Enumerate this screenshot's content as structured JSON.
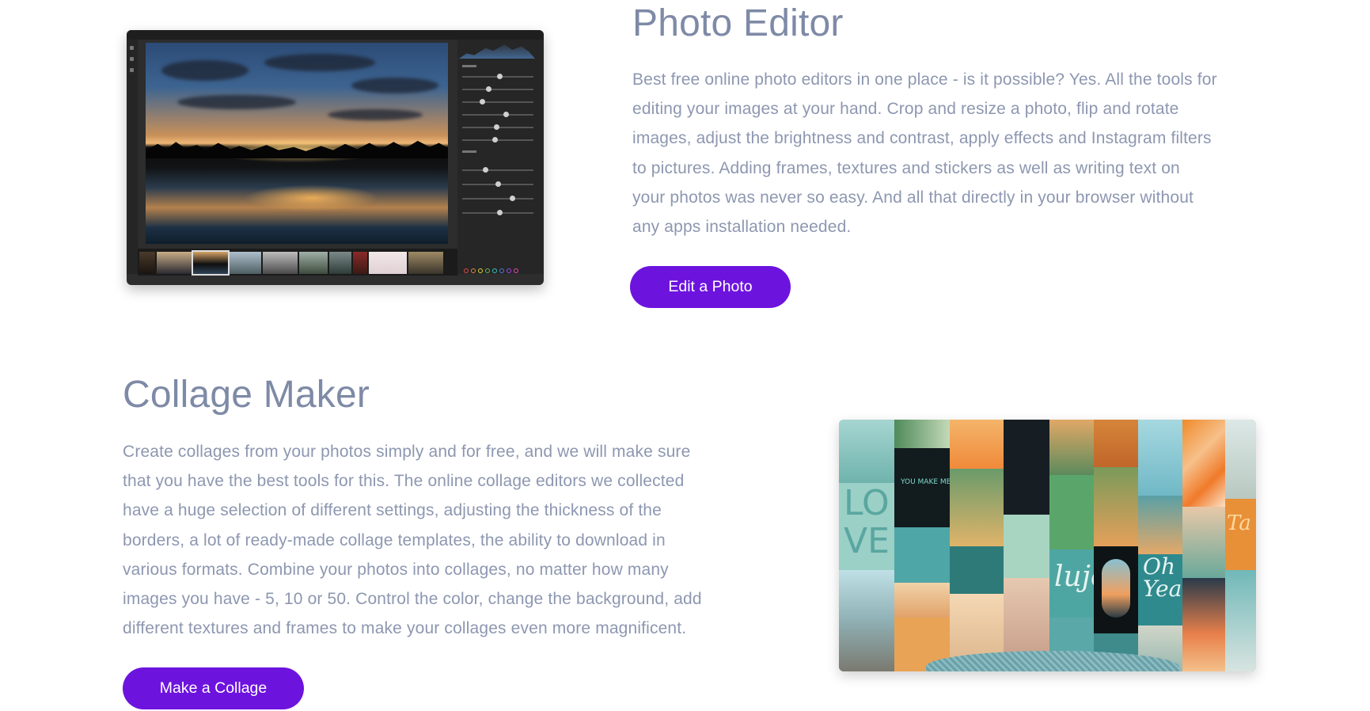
{
  "photo_editor": {
    "title": "Photo Editor",
    "description_lines": [
      "Best free online photo editors in one place - is it possible? Yes. All the tools for",
      "editing your images at your hand. Crop and resize a photo, flip and rotate",
      "images, adjust the brightness and contrast, apply effects and Instagram filters",
      "to pictures. Adding frames, textures and stickers as well as writing text on",
      "your photos was never so easy. And all that directly in your browser without",
      "any apps installation needed."
    ],
    "button_label": "Edit a Photo"
  },
  "collage_maker": {
    "title": "Collage Maker",
    "description_lines": [
      "Create collages from your photos simply and for free, and we will make sure",
      "that you have the best tools for this. The online collage editors we collected",
      "have a huge selection of different settings, adjusting the thickness of the",
      "borders, a lot of ready-made collage templates, the ability to download in",
      "various formats. Combine your photos into collages, no matter how many",
      "images you have - 5, 10 or 50. Control the color, change the background, add",
      "different textures and frames to make your collages even more magnificent."
    ],
    "button_label": "Make a Collage"
  },
  "colors": {
    "accent": "#6d13de",
    "heading": "#7e8aa6",
    "body_text": "#8d97b0",
    "background": "#ffffff"
  }
}
